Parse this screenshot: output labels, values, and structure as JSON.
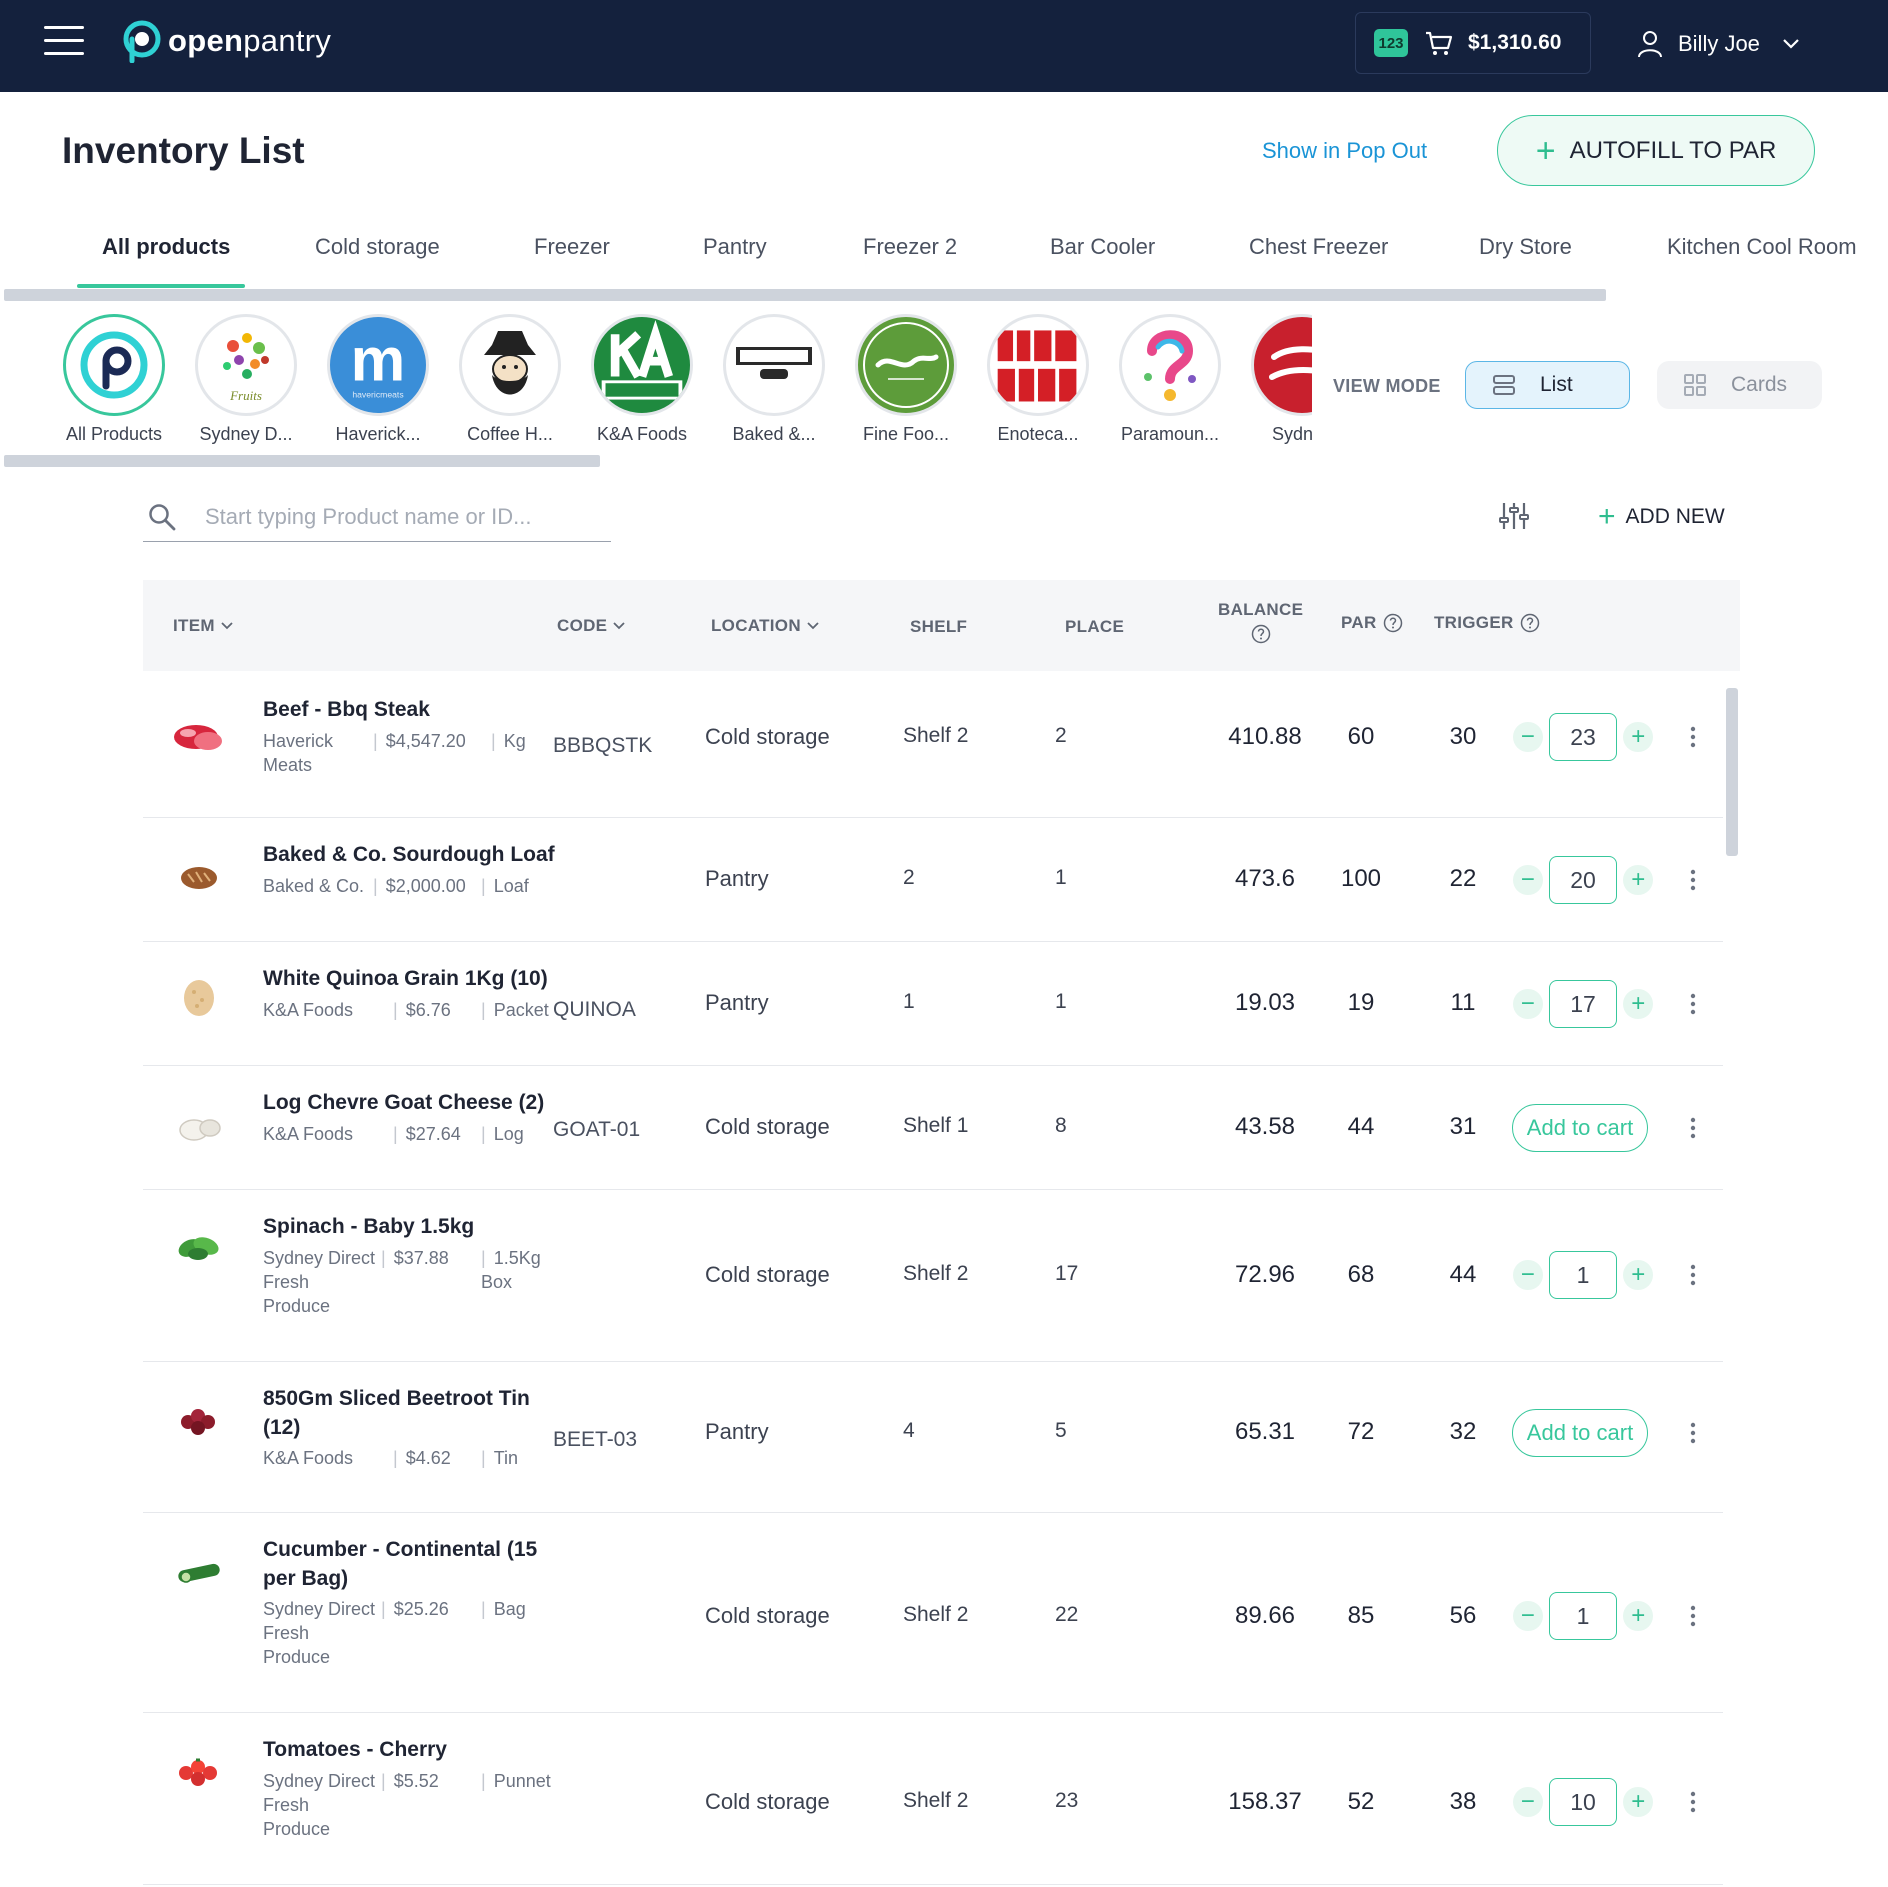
{
  "app": {
    "brand_bold": "open",
    "brand_light": "pantry",
    "cart_badge": "123",
    "cart_total": "$1,310.60",
    "user_name": "Billy Joe",
    "accent": "#38c79c",
    "nav_bg": "#14213d"
  },
  "header": {
    "title": "Inventory List",
    "popout_link": "Show in Pop Out",
    "autofill_label": "AUTOFILL TO PAR"
  },
  "tabs": [
    {
      "label": "All products",
      "active": true
    },
    {
      "label": "Cold storage"
    },
    {
      "label": "Freezer"
    },
    {
      "label": "Pantry"
    },
    {
      "label": "Freezer 2"
    },
    {
      "label": "Bar Cooler"
    },
    {
      "label": "Chest Freezer"
    },
    {
      "label": "Dry Store"
    },
    {
      "label": "Kitchen Cool Room"
    }
  ],
  "suppliers": [
    {
      "label": "All Products",
      "logo": "openpantry-logo",
      "active": true
    },
    {
      "label": "Sydney D...",
      "logo": "fruits-logo"
    },
    {
      "label": "Haverick...",
      "logo": "haverick-meats-logo",
      "logo_text": "havericmeats"
    },
    {
      "label": "Coffee H...",
      "logo": "coffee-house-logo"
    },
    {
      "label": "K&A Foods",
      "logo": "ka-foods-logo"
    },
    {
      "label": "Baked &...",
      "logo": "baked-co-logo"
    },
    {
      "label": "Fine Foo...",
      "logo": "fine-food-logo"
    },
    {
      "label": "Enoteca...",
      "logo": "enoteca-logo"
    },
    {
      "label": "Paramoun...",
      "logo": "paramount-logo"
    },
    {
      "label": "Sydney",
      "logo": "sydney-smallgoods-logo"
    }
  ],
  "view_mode": {
    "label": "VIEW MODE",
    "list_label": "List",
    "cards_label": "Cards",
    "selected": "List"
  },
  "search": {
    "placeholder": "Start typing Product name or ID...",
    "add_new_label": "ADD NEW"
  },
  "table": {
    "columns": {
      "item": "ITEM",
      "code": "CODE",
      "location": "LOCATION",
      "shelf": "SHELF",
      "place": "PLACE",
      "balance": "BALANCE",
      "par": "PAR",
      "trigger": "TRIGGER"
    },
    "add_to_cart_label": "Add to cart",
    "rows": [
      {
        "name": "Beef - Bbq Steak",
        "supplier": "Haverick Meats",
        "price": "$4,547.20",
        "unit": "Kg",
        "code": "BBBQSTK",
        "location": "Cold storage",
        "shelf": "Shelf 2",
        "place": "2",
        "balance": "410.88",
        "par": "60",
        "trigger": "30",
        "qty": "23",
        "thumb": "steak"
      },
      {
        "name": "Baked & Co. Sourdough Loaf",
        "supplier": "Baked & Co.",
        "price": "$2,000.00",
        "unit": "Loaf",
        "code": "",
        "location": "Pantry",
        "shelf": "2",
        "place": "1",
        "balance": "473.6",
        "par": "100",
        "trigger": "22",
        "qty": "20",
        "thumb": "bread"
      },
      {
        "name": "White Quinoa Grain 1Kg (10)",
        "supplier": "K&A Foods",
        "price": "$6.76",
        "unit": "Packet",
        "code": "QUINOA",
        "location": "Pantry",
        "shelf": "1",
        "place": "1",
        "balance": "19.03",
        "par": "19",
        "trigger": "11",
        "qty": "17",
        "thumb": "quinoa"
      },
      {
        "name": "Log Chevre Goat Cheese (2)",
        "supplier": "K&A Foods",
        "price": "$27.64",
        "unit": "Log",
        "code": "GOAT-01",
        "location": "Cold storage",
        "shelf": "Shelf 1",
        "place": "8",
        "balance": "43.58",
        "par": "44",
        "trigger": "31",
        "qty": null,
        "thumb": "cheese"
      },
      {
        "name": "Spinach - Baby 1.5kg",
        "supplier": "Sydney Direct Fresh Produce",
        "price": "$37.88",
        "unit": "1.5Kg Box",
        "code": "",
        "location": "Cold storage",
        "shelf": "Shelf 2",
        "place": "17",
        "balance": "72.96",
        "par": "68",
        "trigger": "44",
        "qty": "1",
        "thumb": "spinach"
      },
      {
        "name": "850Gm Sliced Beetroot Tin (12)",
        "supplier": "K&A Foods",
        "price": "$4.62",
        "unit": "Tin",
        "code": "BEET-03",
        "location": "Pantry",
        "shelf": "4",
        "place": "5",
        "balance": "65.31",
        "par": "72",
        "trigger": "32",
        "qty": null,
        "thumb": "beetroot"
      },
      {
        "name": "Cucumber - Continental (15 per Bag)",
        "supplier": "Sydney Direct Fresh Produce",
        "price": "$25.26",
        "unit": "Bag",
        "code": "",
        "location": "Cold storage",
        "shelf": "Shelf 2",
        "place": "22",
        "balance": "89.66",
        "par": "85",
        "trigger": "56",
        "qty": "1",
        "thumb": "cucumber"
      },
      {
        "name": "Tomatoes - Cherry",
        "supplier": "Sydney Direct Fresh Produce",
        "price": "$5.52",
        "unit": "Punnet",
        "code": "",
        "location": "Cold storage",
        "shelf": "Shelf 2",
        "place": "23",
        "balance": "158.37",
        "par": "52",
        "trigger": "38",
        "qty": "10",
        "thumb": "tomato"
      }
    ]
  }
}
